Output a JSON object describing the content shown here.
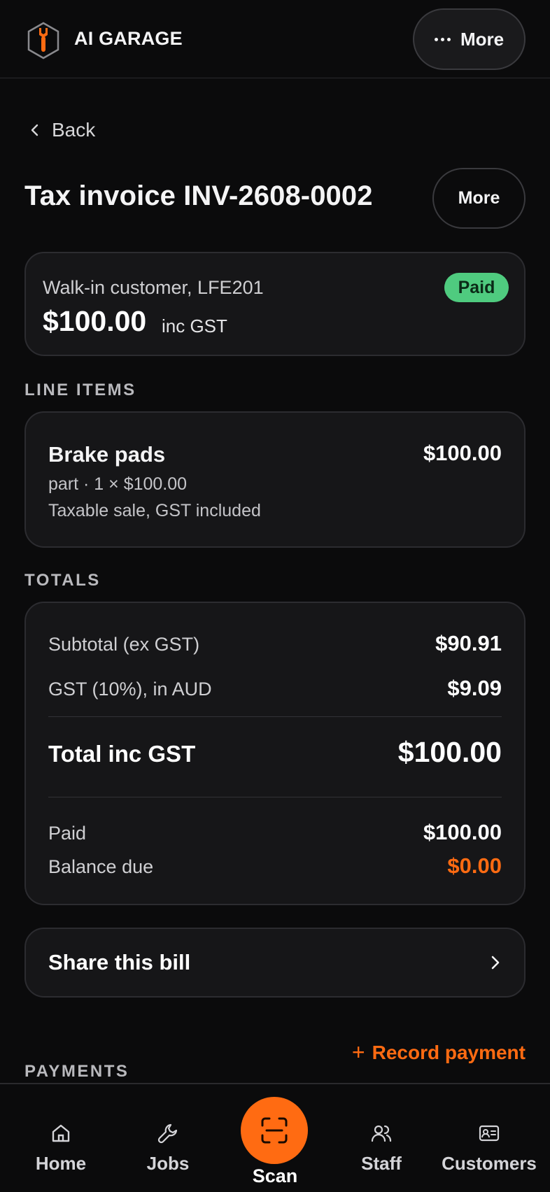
{
  "app": {
    "name": "AI GARAGE",
    "more_label": "More",
    "accent_color": "#ff6b12"
  },
  "nav": {
    "back_label": "Back"
  },
  "invoice": {
    "title": "Tax invoice INV-2608-0002",
    "more_label": "More",
    "customer": "Walk-in customer, LFE201",
    "status": "Paid",
    "amount": "$100.00",
    "amount_suffix": "inc GST"
  },
  "line_items": {
    "section_label": "LINE ITEMS",
    "items": [
      {
        "name": "Brake pads",
        "detail": "part · 1 × $100.00",
        "tax_note": "Taxable sale, GST included",
        "price": "$100.00"
      }
    ]
  },
  "totals": {
    "section_label": "TOTALS",
    "subtotal_label": "Subtotal (ex GST)",
    "subtotal_value": "$90.91",
    "gst_label": "GST (10%), in AUD",
    "gst_value": "$9.09",
    "total_label": "Total inc GST",
    "total_value": "$100.00",
    "paid_label": "Paid",
    "paid_value": "$100.00",
    "balance_label": "Balance due",
    "balance_value": "$0.00"
  },
  "share": {
    "label": "Share this bill"
  },
  "payments": {
    "record_label": "Record payment",
    "section_label": "PAYMENTS"
  },
  "bottom_nav": {
    "home": "Home",
    "jobs": "Jobs",
    "scan": "Scan",
    "staff": "Staff",
    "customers": "Customers"
  }
}
